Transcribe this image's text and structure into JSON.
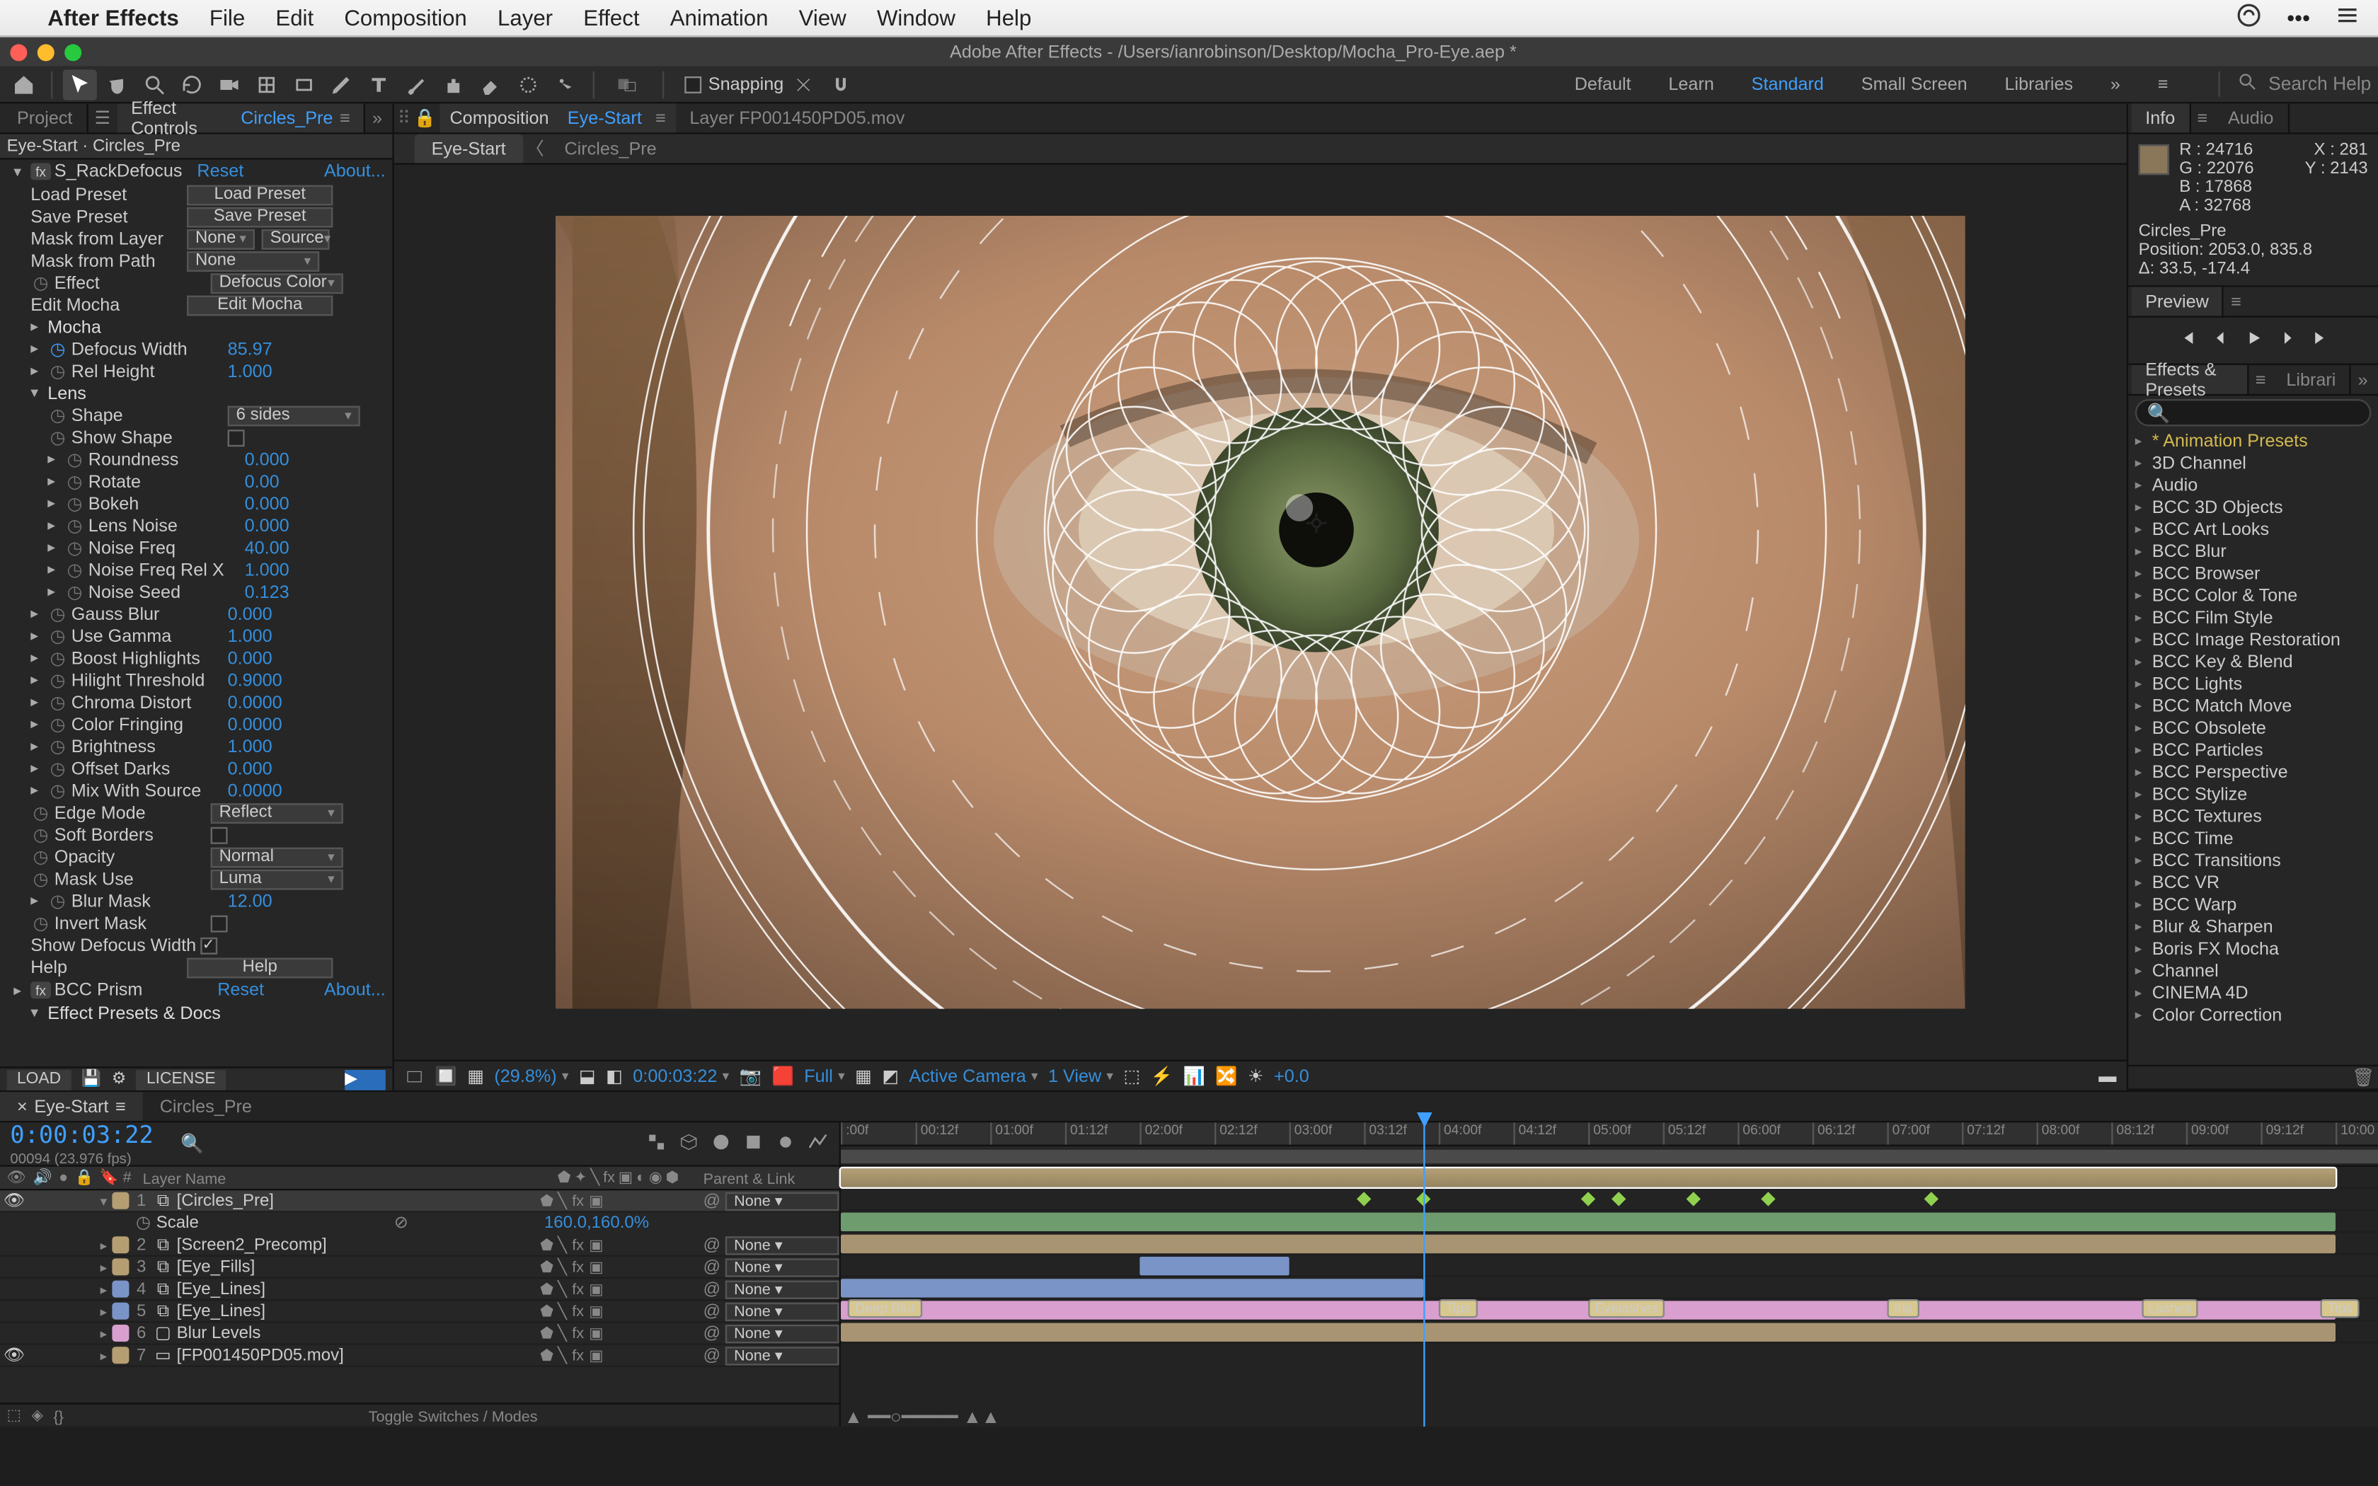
{
  "mac_menu": {
    "app": "After Effects",
    "items": [
      "File",
      "Edit",
      "Composition",
      "Layer",
      "Effect",
      "Animation",
      "View",
      "Window",
      "Help"
    ]
  },
  "window": {
    "title": "Adobe After Effects - /Users/ianrobinson/Desktop/Mocha_Pro-Eye.aep *"
  },
  "toolbar": {
    "snapping": "Snapping"
  },
  "workspaces": [
    "Default",
    "Learn",
    "Standard",
    "Small Screen",
    "Libraries"
  ],
  "workspace_active": "Standard",
  "search_help_ph": "Search Help",
  "left_tabs": {
    "project": "Project",
    "effect_controls": "Effect Controls",
    "effect_controls_target": "Circles_Pre"
  },
  "effect_header": "Eye-Start · Circles_Pre",
  "effect": {
    "name": "S_RackDefocus",
    "reset": "Reset",
    "about": "About...",
    "load_preset_lbl": "Load Preset",
    "load_preset_btn": "Load Preset",
    "save_preset_lbl": "Save Preset",
    "save_preset_btn": "Save Preset",
    "mask_from_layer_lbl": "Mask from Layer",
    "mask_from_layer_val": "None",
    "mask_from_layer_src": "Source",
    "mask_from_path_lbl": "Mask from Path",
    "mask_from_path_val": "None",
    "effect_lbl": "Effect",
    "effect_val": "Defocus Color",
    "edit_mocha_lbl": "Edit Mocha",
    "edit_mocha_btn": "Edit Mocha",
    "mocha_grp": "Mocha",
    "defocus_width_lbl": "Defocus Width",
    "defocus_width_val": "85.97",
    "rel_height_lbl": "Rel Height",
    "rel_height_val": "1.000",
    "lens_grp": "Lens",
    "shape_lbl": "Shape",
    "shape_val": "6 sides",
    "show_shape_lbl": "Show Shape",
    "roundness_lbl": "Roundness",
    "roundness_val": "0.000",
    "rotate_lbl": "Rotate",
    "rotate_val": "0.00",
    "bokeh_lbl": "Bokeh",
    "bokeh_val": "0.000",
    "lens_noise_lbl": "Lens Noise",
    "lens_noise_val": "0.000",
    "noise_freq_lbl": "Noise Freq",
    "noise_freq_val": "40.00",
    "noise_freq_relx_lbl": "Noise Freq Rel X",
    "noise_freq_relx_val": "1.000",
    "noise_seed_lbl": "Noise Seed",
    "noise_seed_val": "0.123",
    "gauss_blur_lbl": "Gauss Blur",
    "gauss_blur_val": "0.000",
    "use_gamma_lbl": "Use Gamma",
    "use_gamma_val": "1.000",
    "boost_hl_lbl": "Boost Highlights",
    "boost_hl_val": "0.000",
    "hl_thresh_lbl": "Hilight Threshold",
    "hl_thresh_val": "0.9000",
    "chroma_lbl": "Chroma Distort",
    "chroma_val": "0.0000",
    "color_fring_lbl": "Color Fringing",
    "color_fring_val": "0.0000",
    "brightness_lbl": "Brightness",
    "brightness_val": "1.000",
    "offset_darks_lbl": "Offset Darks",
    "offset_darks_val": "0.000",
    "mix_src_lbl": "Mix With Source",
    "mix_src_val": "0.0000",
    "edge_mode_lbl": "Edge Mode",
    "edge_mode_val": "Reflect",
    "soft_borders_lbl": "Soft Borders",
    "opacity_lbl": "Opacity",
    "opacity_val": "Normal",
    "mask_use_lbl": "Mask Use",
    "mask_use_val": "Luma",
    "blur_mask_lbl": "Blur Mask",
    "blur_mask_val": "12.00",
    "invert_mask_lbl": "Invert Mask",
    "show_def_w_lbl": "Show Defocus Width",
    "help_lbl": "Help",
    "help_btn": "Help",
    "bcc_prism": "BCC Prism",
    "presets_docs": "Effect Presets & Docs"
  },
  "license": {
    "load": "LOAD",
    "license": "LICENSE"
  },
  "comp_tabs": {
    "composition_lbl": "Composition",
    "composition_name": "Eye-Start",
    "layer_tab": "Layer FP001450PD05.mov"
  },
  "comp_sub_tabs": [
    "Eye-Start",
    "Circles_Pre"
  ],
  "comp_sub_active": "Eye-Start",
  "comp_footer": {
    "mag": "(29.8%)",
    "time": "0:00:03:22",
    "res": "Full",
    "camera": "Active Camera",
    "view": "1 View",
    "exposure": "+0.0"
  },
  "right": {
    "info_tab": "Info",
    "audio_tab": "Audio",
    "r": "R :",
    "r_v": "24716",
    "g": "G :",
    "g_v": "22076",
    "b": "B :",
    "b_v": "17868",
    "a": "A :",
    "a_v": "32768",
    "x": "X :",
    "x_v": "281",
    "y": "Y :",
    "y_v": "2143",
    "layer_name": "Circles_Pre",
    "position": "Position: 2053.0, 835.8",
    "delta": "Δ: 33.5, -174.4",
    "preview_tab": "Preview",
    "ep_tab": "Effects & Presets",
    "lib_tab": "Librari"
  },
  "ep_cats": [
    "* Animation Presets",
    "3D Channel",
    "Audio",
    "BCC 3D Objects",
    "BCC Art Looks",
    "BCC Blur",
    "BCC Browser",
    "BCC Color & Tone",
    "BCC Film Style",
    "BCC Image Restoration",
    "BCC Key & Blend",
    "BCC Lights",
    "BCC Match Move",
    "BCC Obsolete",
    "BCC Particles",
    "BCC Perspective",
    "BCC Stylize",
    "BCC Textures",
    "BCC Time",
    "BCC Transitions",
    "BCC VR",
    "BCC Warp",
    "Blur & Sharpen",
    "Boris FX Mocha",
    "Channel",
    "CINEMA 4D",
    "Color Correction"
  ],
  "tl_tabs": [
    "Eye-Start",
    "Circles_Pre"
  ],
  "tl_tab_active": "Eye-Start",
  "tl_timecode": "0:00:03:22",
  "tl_frame_sub": "00094 (23.976 fps)",
  "tl_col": {
    "layer_name": "Layer Name",
    "parent": "Parent & Link"
  },
  "ruler_ticks": [
    ":00f",
    "00:12f",
    "01:00f",
    "01:12f",
    "02:00f",
    "02:12f",
    "03:00f",
    "03:12f",
    "04:00f",
    "04:12f",
    "05:00f",
    "05:12f",
    "06:00f",
    "06:12f",
    "07:00f",
    "07:12f",
    "08:00f",
    "08:12f",
    "09:00f",
    "09:12f",
    "10:00"
  ],
  "layers": [
    {
      "num": "1",
      "name": "[Circles_Pre]",
      "color": "#b59e72",
      "sel": true,
      "type": "comp",
      "parent": "None",
      "eye": true
    },
    {
      "num": "2",
      "name": "[Screen2_Precomp]",
      "color": "#b59e72",
      "type": "comp",
      "parent": "None"
    },
    {
      "num": "3",
      "name": "[Eye_Fills]",
      "color": "#b59e72",
      "type": "comp",
      "parent": "None"
    },
    {
      "num": "4",
      "name": "[Eye_Lines]",
      "color": "#7a94c8",
      "type": "comp",
      "parent": "None"
    },
    {
      "num": "5",
      "name": "[Eye_Lines]",
      "color": "#7a94c8",
      "type": "comp",
      "parent": "None"
    },
    {
      "num": "6",
      "name": "Blur Levels",
      "color": "#d89fcf",
      "type": "adjust",
      "parent": "None"
    },
    {
      "num": "7",
      "name": "[FP001450PD05.mov]",
      "color": "#b59e72",
      "type": "footage",
      "parent": "None",
      "eye": true
    }
  ],
  "prop": {
    "name": "Scale",
    "val": "160.0,160.0%"
  },
  "markers": [
    "Deep Blur",
    "Tips",
    "Eyelashes",
    "Iris",
    "Lashes",
    "Tips"
  ],
  "tl_footer": {
    "toggle": "Toggle Switches / Modes"
  }
}
